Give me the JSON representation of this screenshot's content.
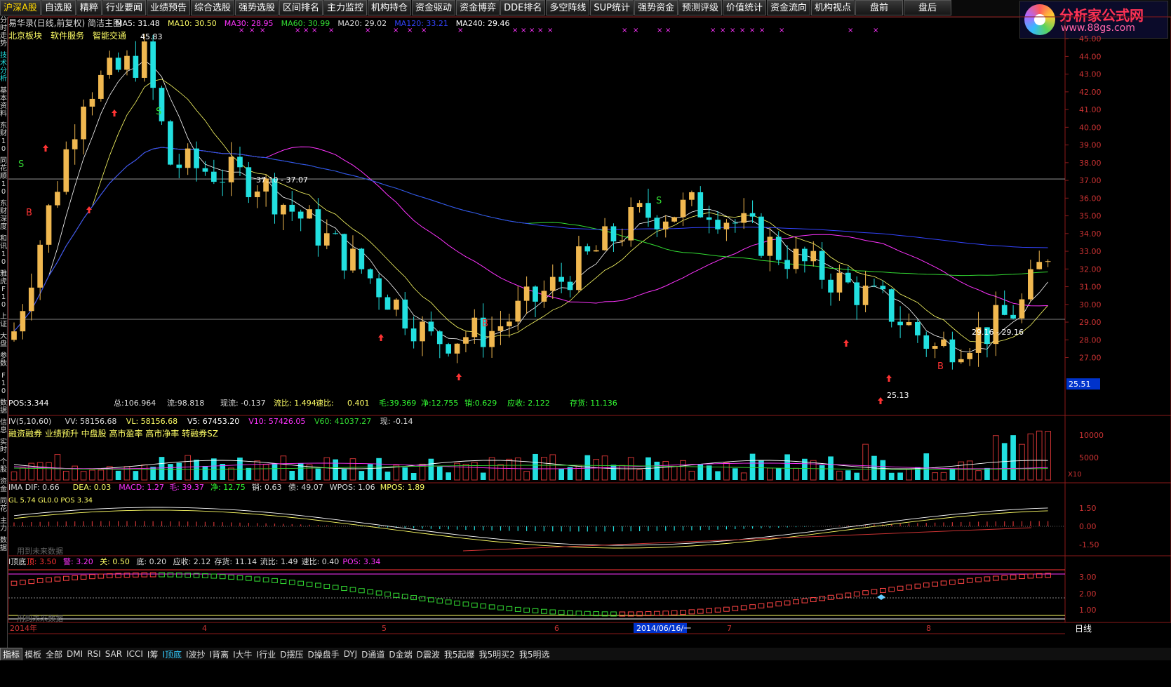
{
  "menu": [
    "沪深A股",
    "自选股",
    "精粹",
    "行业要闻",
    "业绩预告",
    "综合选股",
    "强势选股",
    "区间排名",
    "主力监控",
    "机构持仓",
    "资金驱动",
    "资金博弈",
    "DDE排名",
    "多空阵线",
    "SUP统计",
    "强势资金",
    "预测评级",
    "价值统计",
    "资金流向",
    "机构视点",
    "盘前",
    "盘后"
  ],
  "logo": {
    "name": "分析家公式网",
    "url": "www.88gs.com"
  },
  "left_tabs": [
    "分时走势",
    "技术分析",
    "基本资料",
    "东财10",
    "同花顺10",
    "东财深度",
    "和讯10",
    "雅虎F10",
    "上证",
    "大盘",
    "参数",
    "F10",
    "数据",
    "信息",
    "实时",
    "个股",
    "资金",
    "同花",
    "主力",
    "数据"
  ],
  "main": {
    "header_title": "易华录(日线,前复权) 简洁主图",
    "ma": [
      {
        "label": "MA5: 31.48",
        "color": "#ffffff"
      },
      {
        "label": "MA10: 30.50",
        "color": "#ffff66"
      },
      {
        "label": "MA30: 28.95",
        "color": "#ff33ff"
      },
      {
        "label": "MA60: 30.99",
        "color": "#33dd33"
      },
      {
        "label": "MA20: 29.02",
        "color": "#dddddd"
      },
      {
        "label": "MA120: 33.21",
        "color": "#3344ff"
      },
      {
        "label": "MA240: 29.46",
        "color": "#ffffff"
      }
    ],
    "sectors": [
      "北京板块",
      "软件服务",
      "智能交通"
    ],
    "price_axis": [
      "45.00",
      "44.00",
      "43.00",
      "42.00",
      "41.00",
      "40.00",
      "39.00",
      "38.00",
      "37.00",
      "36.00",
      "35.00",
      "34.00",
      "33.00",
      "32.00",
      "31.00",
      "30.00",
      "29.00",
      "28.00",
      "27.00"
    ],
    "current_price": "25.51",
    "annotations": {
      "high": "45.83",
      "low": "25.13",
      "line1": "37.10 - 37.07",
      "line2": "29.16 - 29.16"
    },
    "markers": {
      "s": "S",
      "b": "B"
    },
    "stats": [
      {
        "text": "POS:3.344",
        "color": "#ffffff"
      },
      {
        "text": "总:106.964",
        "color": "#dddddd"
      },
      {
        "text": "流:98.818",
        "color": "#dddddd"
      },
      {
        "text": "现流: -0.137",
        "color": "#dddddd"
      },
      {
        "text": "流比: 1.494",
        "color": "#ffff66"
      },
      {
        "text": "速比:",
        "color": "#ffff66"
      },
      {
        "text": "0.401",
        "color": "#ffff66"
      },
      {
        "text": "毛:39.369",
        "color": "#33ff33"
      },
      {
        "text": "净:12.755",
        "color": "#33ff33"
      },
      {
        "text": "销:0.629",
        "color": "#33ff33"
      },
      {
        "text": "应收: 2.122",
        "color": "#33ff33"
      },
      {
        "text": "存货: 11.136",
        "color": "#33ff33"
      }
    ]
  },
  "vol": {
    "header": [
      {
        "text": "IV(5,10,60)",
        "color": "#dddddd"
      },
      {
        "text": "VV: 58156.68",
        "color": "#dddddd"
      },
      {
        "text": "VL: 58156.68",
        "color": "#ffff66"
      },
      {
        "text": "V5: 67453.20",
        "color": "#ffffff"
      },
      {
        "text": "V10: 57426.05",
        "color": "#ff33ff"
      },
      {
        "text": "V60: 41037.27",
        "color": "#33dd33"
      },
      {
        "text": "现: -0.14",
        "color": "#dddddd"
      }
    ],
    "tags": "融资融券 业绩预升 中盘股 高市盈率 高市净率 转融券SZ",
    "axis": [
      "10000",
      "5000"
    ],
    "unit": "X10"
  },
  "macd": {
    "header": [
      {
        "text": "IMA DIF: 0.66",
        "color": "#dddddd"
      },
      {
        "text": "DEA: 0.03",
        "color": "#ffff66"
      },
      {
        "text": "MACD: 1.27",
        "color": "#ff33ff"
      },
      {
        "text": "毛: 39.37",
        "color": "#ff33ff"
      },
      {
        "text": "净: 12.75",
        "color": "#33ff33"
      },
      {
        "text": "销: 0.63",
        "color": "#dddddd"
      },
      {
        "text": "债: 49.07",
        "color": "#dddddd"
      },
      {
        "text": "WPOS: 1.06",
        "color": "#dddddd"
      },
      {
        "text": "MPOS: 1.89",
        "color": "#ffff66"
      }
    ],
    "sub": "GL 5.74  GL0.0  POS 3.34",
    "axis": [
      "1.50",
      "0.00",
      "-1.50"
    ],
    "future": "用到未来数据"
  },
  "topbottom": {
    "header": [
      {
        "text": "I顶底",
        "color": "#dddddd"
      },
      {
        "text": "顶: 3.50",
        "color": "#ff3333"
      },
      {
        "text": "警: 3.20",
        "color": "#ff33ff"
      },
      {
        "text": "关: 0.50",
        "color": "#ffff66"
      },
      {
        "text": "底: 0.20",
        "color": "#dddddd"
      },
      {
        "text": "应收: 2.12",
        "color": "#dddddd"
      },
      {
        "text": "存货: 11.14",
        "color": "#dddddd"
      },
      {
        "text": "流比: 1.49",
        "color": "#dddddd"
      },
      {
        "text": "速比: 0.40",
        "color": "#dddddd"
      },
      {
        "text": "POS: 3.34",
        "color": "#ff33ff"
      }
    ],
    "axis": [
      "3.00",
      "2.00",
      "1.00"
    ],
    "future": "用到未来数据"
  },
  "dates": [
    "2014年",
    "4",
    "5",
    "6",
    "2014/06/16/一",
    "7",
    "8"
  ],
  "period": "日线",
  "tabs": [
    "指标",
    "模板",
    "全部",
    "DMI",
    "RSI",
    "SAR",
    "ICCI",
    "I筹",
    "I顶底",
    "I波抄",
    "I背离",
    "I大牛",
    "I行业",
    "D摆压",
    "D操盘手",
    "DYJ",
    "D通道",
    "D金端",
    "D震波",
    "我5起爆",
    "我5明买2",
    "我5明选"
  ]
}
